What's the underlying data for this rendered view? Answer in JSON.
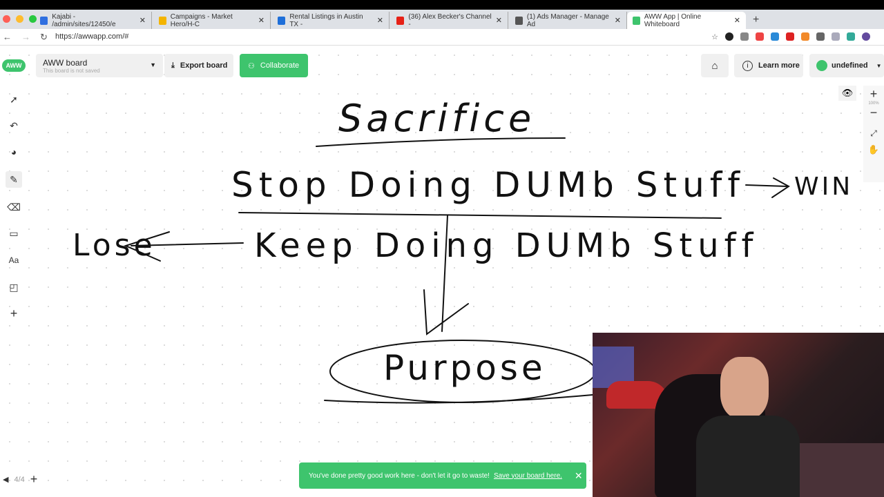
{
  "browser": {
    "tabs": [
      {
        "title": "Kajabi - /admin/sites/12450/e",
        "color": "#2f6fe0"
      },
      {
        "title": "Campaigns - Market Hero/H-C",
        "color": "#f4b400"
      },
      {
        "title": "Rental Listings in Austin TX -",
        "color": "#1e6fd9"
      },
      {
        "title": "(36) Alex Becker's Channel -",
        "color": "#e62117"
      },
      {
        "title": "(1) Ads Manager - Manage Ad",
        "color": "#555555"
      },
      {
        "title": "AWW App | Online Whiteboard",
        "color": "#3ec46d"
      }
    ],
    "url": "https://awwapp.com/#"
  },
  "app": {
    "logo": "AWW",
    "board_name": "AWW board",
    "board_status": "This board is not saved",
    "export_label": "Export board",
    "collaborate_label": "Collaborate",
    "learn_more_label": "Learn more",
    "user_label": "undefined",
    "zoom_level": "100%",
    "page_indicator": "4/4",
    "accent_color": "#3ec46d"
  },
  "board_text": [
    "Sacrifice",
    "Stop Doing DUMb Stuff",
    "WIN",
    "Lose",
    "Keep Doing DUMb Stuff",
    "Purpose"
  ],
  "toast": {
    "message": "You've done pretty good work here - don't let it go to waste!",
    "link": "Save your board here."
  }
}
